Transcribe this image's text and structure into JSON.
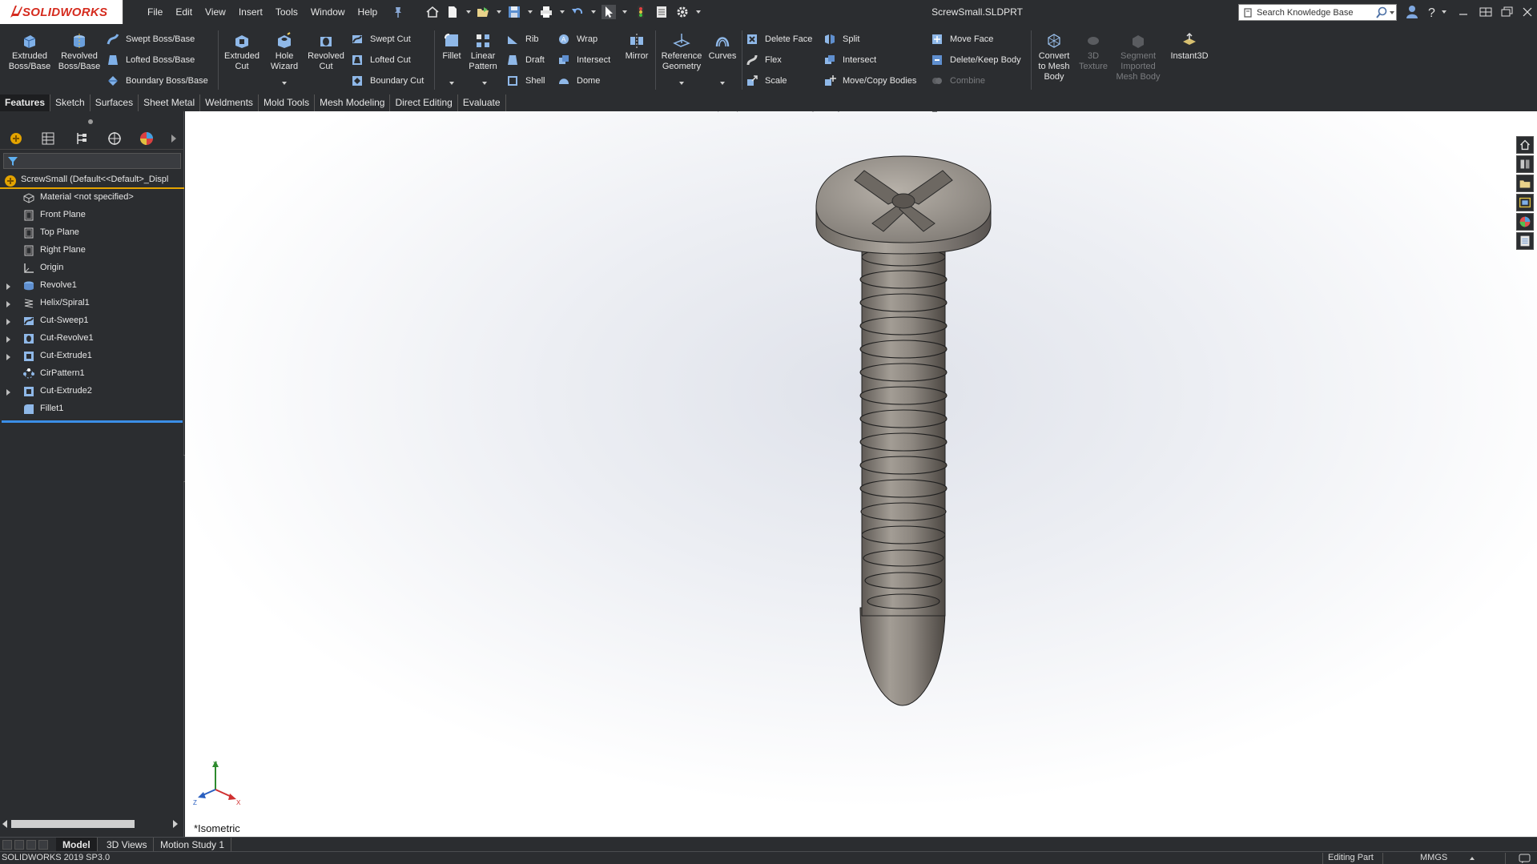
{
  "app": {
    "logo_text": "SOLIDWORKS",
    "document_title": "ScrewSmall.SLDPRT"
  },
  "menu": [
    "File",
    "Edit",
    "View",
    "Insert",
    "Tools",
    "Window",
    "Help"
  ],
  "search": {
    "placeholder": "Search Knowledge Base"
  },
  "command_manager": {
    "extruded_boss": [
      "Extruded",
      "Boss/Base"
    ],
    "revolved_boss": [
      "Revolved",
      "Boss/Base"
    ],
    "swept_boss": "Swept Boss/Base",
    "lofted_boss": "Lofted Boss/Base",
    "boundary_boss": "Boundary Boss/Base",
    "extruded_cut": [
      "Extruded",
      "Cut"
    ],
    "hole_wizard": [
      "Hole",
      "Wizard"
    ],
    "revolved_cut": [
      "Revolved",
      "Cut"
    ],
    "swept_cut": "Swept Cut",
    "lofted_cut": "Lofted Cut",
    "boundary_cut": "Boundary Cut",
    "fillet": "Fillet",
    "linear_pattern": [
      "Linear",
      "Pattern"
    ],
    "rib": "Rib",
    "draft": "Draft",
    "shell": "Shell",
    "wrap": "Wrap",
    "intersect": "Intersect",
    "dome": "Dome",
    "mirror": "Mirror",
    "reference_geometry": [
      "Reference",
      "Geometry"
    ],
    "curves": "Curves",
    "delete_face": "Delete Face",
    "flex": "Flex",
    "scale": "Scale",
    "split": "Split",
    "intersect2": "Intersect",
    "move_copy_bodies": "Move/Copy Bodies",
    "move_face": "Move Face",
    "delete_keep_body": "Delete/Keep Body",
    "combine": "Combine",
    "convert_mesh": [
      "Convert",
      "to Mesh",
      "Body"
    ],
    "texture_3d": [
      "3D",
      "Texture"
    ],
    "segment_mesh": [
      "Segment",
      "Imported",
      "Mesh Body"
    ],
    "instant3d": "Instant3D"
  },
  "tabs": [
    "Features",
    "Sketch",
    "Surfaces",
    "Sheet Metal",
    "Weldments",
    "Mold Tools",
    "Mesh Modeling",
    "Direct Editing",
    "Evaluate"
  ],
  "feature_tree": {
    "root": "ScrewSmall  (Default<<Default>_Displ",
    "items": [
      {
        "label": "Material <not specified>",
        "expandable": false
      },
      {
        "label": "Front Plane",
        "expandable": false
      },
      {
        "label": "Top Plane",
        "expandable": false
      },
      {
        "label": "Right Plane",
        "expandable": false
      },
      {
        "label": "Origin",
        "expandable": false
      },
      {
        "label": "Revolve1",
        "expandable": true
      },
      {
        "label": "Helix/Spiral1",
        "expandable": true
      },
      {
        "label": "Cut-Sweep1",
        "expandable": true
      },
      {
        "label": "Cut-Revolve1",
        "expandable": true
      },
      {
        "label": "Cut-Extrude1",
        "expandable": true
      },
      {
        "label": "CirPattern1",
        "expandable": false
      },
      {
        "label": "Cut-Extrude2",
        "expandable": true
      },
      {
        "label": "Fillet1",
        "expandable": false
      }
    ]
  },
  "viewport": {
    "view_name": "*Isometric"
  },
  "model_tabs": [
    "Model",
    "3D Views",
    "Motion Study 1"
  ],
  "status": {
    "version": "SOLIDWORKS 2019 SP3.0",
    "mode": "Editing Part",
    "units": "MMGS"
  },
  "colors": {
    "accent": "#d52b1e",
    "rollback": "#3b8ee6",
    "root_underline": "#e3a300",
    "panel": "#2b2d30"
  },
  "icons": {
    "quick_access": [
      "home-icon",
      "new-document-icon",
      "open-icon",
      "save-icon",
      "print-icon",
      "undo-icon",
      "select-icon",
      "rebuild-icon",
      "file-properties-icon",
      "options-icon"
    ],
    "heads_up": [
      "zoom-to-fit-icon",
      "zoom-to-area-icon",
      "previous-view-icon",
      "section-view-icon",
      "dynamic-annotation-icon",
      "view-orientation-icon",
      "display-style-icon",
      "hide-show-icon",
      "edit-appearance-icon",
      "apply-scene-icon",
      "view-settings-icon"
    ]
  }
}
